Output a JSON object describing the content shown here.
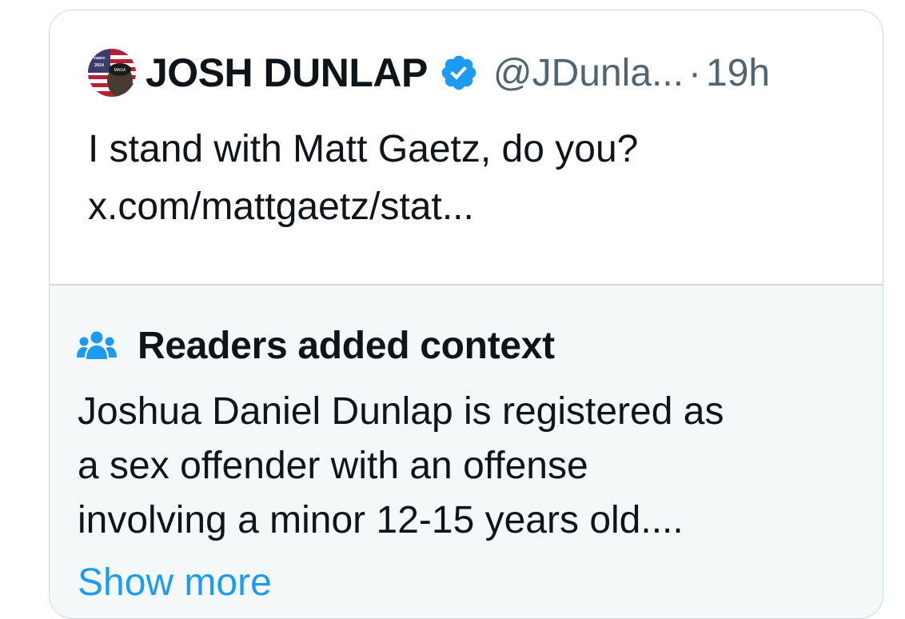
{
  "post": {
    "display_name": "JOSH DUNLAP",
    "handle": "@JDunla...",
    "separator": "·",
    "time": "19h",
    "text_lines": [
      "I stand with Matt Gaetz, do you?",
      "x.com/mattgaetz/stat..."
    ],
    "avatar_text": {
      "line1": "Vance",
      "line2": "2024",
      "hat": "MAGA"
    }
  },
  "notes": {
    "title": "Readers added context",
    "body_lines": [
      "Joshua Daniel Dunlap is registered as",
      "a sex offender with an offense",
      "involving a minor 12-15 years old...."
    ],
    "show_more": "Show more"
  },
  "colors": {
    "text": "#0f1419",
    "secondary": "#536471",
    "accent": "#1d9bf0",
    "notes_bg": "#f5f8f8",
    "border": "#cfd9de"
  },
  "icons": [
    "verified-badge-icon",
    "people-icon"
  ]
}
